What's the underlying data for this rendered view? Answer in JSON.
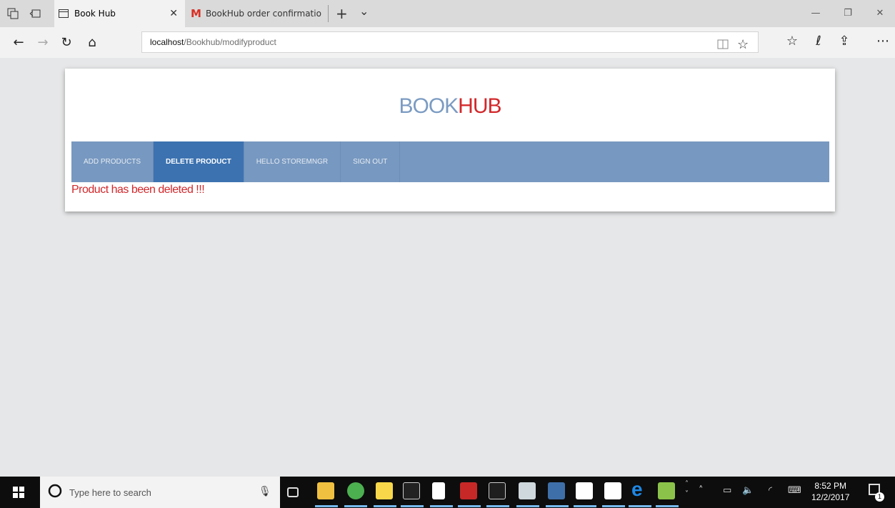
{
  "browser": {
    "active_tab": {
      "title": "Book Hub",
      "close": "✕"
    },
    "inactive_tab": {
      "title": "BookHub order confirmatio"
    },
    "new_tab": "+",
    "tab_list": "⌄",
    "window_controls": {
      "minimize": "—",
      "restore": "❐",
      "close": "✕"
    },
    "address": {
      "host": "localhost",
      "path": "/Bookhub/modifyproduct"
    }
  },
  "page": {
    "logo": {
      "part1": "BOOK",
      "part2": "HUB"
    },
    "menu": [
      {
        "label": "ADD PRODUCTS",
        "active": false
      },
      {
        "label": "DELETE PRODUCT",
        "active": true
      },
      {
        "label": "HELLO STOREMNGR",
        "active": false
      },
      {
        "label": "SIGN OUT",
        "active": false
      }
    ],
    "message": "Product has been deleted !!!",
    "colors": {
      "menu_bg": "#7798c0",
      "menu_active": "#3c72b0",
      "accent_red": "#d2282b",
      "logo_blue": "#7b9bc2"
    }
  },
  "taskbar": {
    "search_placeholder": "Type here to search",
    "time": "8:52 PM",
    "date": "12/2/2017",
    "notification_count": "1"
  }
}
